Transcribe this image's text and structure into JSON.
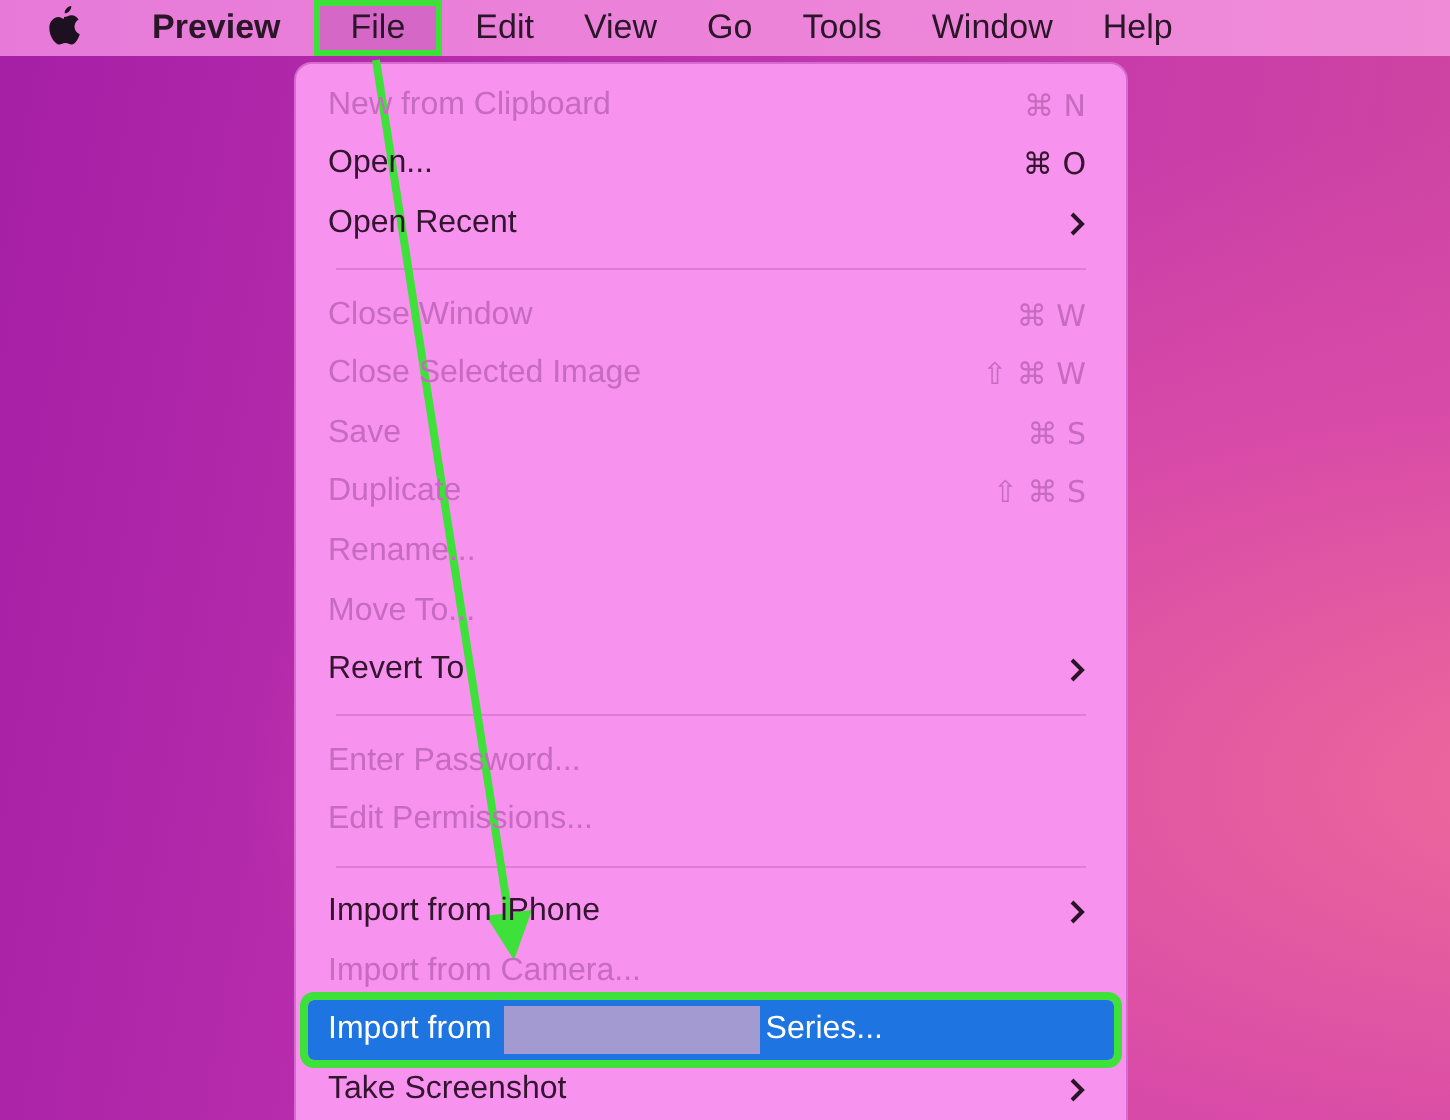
{
  "menubar": {
    "items": [
      {
        "label": "Preview",
        "kind": "app",
        "annotated": false
      },
      {
        "label": "File",
        "kind": "menu",
        "annotated": true
      },
      {
        "label": "Edit",
        "kind": "menu",
        "annotated": false
      },
      {
        "label": "View",
        "kind": "menu",
        "annotated": false
      },
      {
        "label": "Go",
        "kind": "menu",
        "annotated": false
      },
      {
        "label": "Tools",
        "kind": "menu",
        "annotated": false
      },
      {
        "label": "Window",
        "kind": "menu",
        "annotated": false
      },
      {
        "label": "Help",
        "kind": "menu",
        "annotated": false
      }
    ]
  },
  "menu": {
    "items": [
      {
        "kind": "item",
        "label": "New from Clipboard",
        "shortcut": "⌘ N",
        "disabled": true,
        "submenu": false,
        "selected": false
      },
      {
        "kind": "item",
        "label": "Open...",
        "shortcut": "⌘ O",
        "disabled": false,
        "submenu": false,
        "selected": false
      },
      {
        "kind": "item",
        "label": "Open Recent",
        "disabled": false,
        "submenu": true,
        "selected": false
      },
      {
        "kind": "separator"
      },
      {
        "kind": "item",
        "label": "Close Window",
        "shortcut": "⌘ W",
        "disabled": true,
        "submenu": false,
        "selected": false
      },
      {
        "kind": "item",
        "label": "Close Selected Image",
        "shortcut": "⇧ ⌘ W",
        "disabled": true,
        "submenu": false,
        "selected": false
      },
      {
        "kind": "item",
        "label": "Save",
        "shortcut": "⌘ S",
        "disabled": true,
        "submenu": false,
        "selected": false
      },
      {
        "kind": "item",
        "label": "Duplicate",
        "shortcut": "⇧ ⌘ S",
        "disabled": true,
        "submenu": false,
        "selected": false
      },
      {
        "kind": "item",
        "label": "Rename...",
        "disabled": true,
        "submenu": false,
        "selected": false
      },
      {
        "kind": "item",
        "label": "Move To...",
        "disabled": true,
        "submenu": false,
        "selected": false
      },
      {
        "kind": "item",
        "label": "Revert To",
        "disabled": false,
        "submenu": true,
        "selected": false
      },
      {
        "kind": "separator"
      },
      {
        "kind": "item",
        "label": "Enter Password...",
        "disabled": true,
        "submenu": false,
        "selected": false
      },
      {
        "kind": "item",
        "label": "Edit Permissions...",
        "disabled": true,
        "submenu": false,
        "selected": false
      },
      {
        "kind": "separator"
      },
      {
        "kind": "item",
        "label": "Import from iPhone",
        "disabled": false,
        "submenu": true,
        "selected": false
      },
      {
        "kind": "item",
        "label": "Import from Camera...",
        "disabled": true,
        "submenu": false,
        "selected": false
      },
      {
        "kind": "item",
        "label": "Import from",
        "label_end": "Series...",
        "redacted": true,
        "disabled": false,
        "submenu": false,
        "selected": true,
        "annotated": true
      },
      {
        "kind": "item",
        "label": "Take Screenshot",
        "disabled": false,
        "submenu": true,
        "selected": false
      }
    ]
  }
}
